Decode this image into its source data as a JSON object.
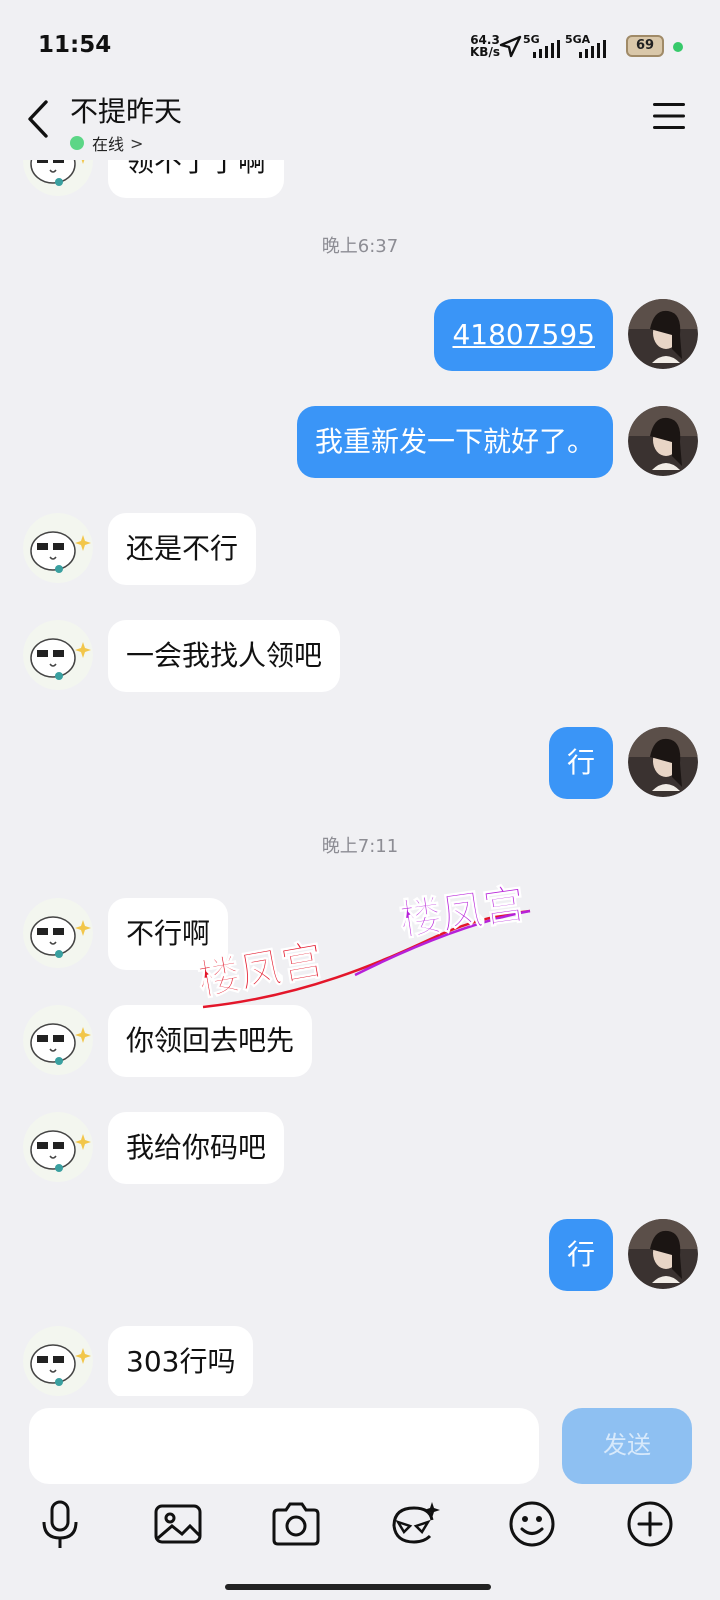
{
  "status_bar": {
    "time": "11:54",
    "net_speed_value": "64.3",
    "net_speed_unit": "KB/s",
    "sim1_label": "5G",
    "sim2_label": "5GA",
    "battery_level": "69",
    "indicator_color": "#37c96a"
  },
  "header": {
    "title": "不提昨天",
    "presence": "在线",
    "presence_chevron": ">",
    "back_icon": "chevron-left-icon",
    "menu_icon": "hamburger-menu-icon"
  },
  "messages": [
    {
      "side": "left",
      "type": "text",
      "text": "领不了了啊",
      "partially_hidden": true
    },
    {
      "type": "timestamp",
      "text": "晚上6:37"
    },
    {
      "side": "right",
      "type": "link",
      "text": "41807595"
    },
    {
      "side": "right",
      "type": "text",
      "text": "我重新发一下就好了。"
    },
    {
      "side": "left",
      "type": "text",
      "text": "还是不行"
    },
    {
      "side": "left",
      "type": "text",
      "text": "一会我找人领吧"
    },
    {
      "side": "right",
      "type": "text",
      "text": "行"
    },
    {
      "type": "timestamp",
      "text": "晚上7:11"
    },
    {
      "side": "left",
      "type": "text",
      "text": "不行啊"
    },
    {
      "side": "left",
      "type": "text",
      "text": "你领回去吧先"
    },
    {
      "side": "left",
      "type": "text",
      "text": "我给你码吧"
    },
    {
      "side": "right",
      "type": "text",
      "text": "行"
    },
    {
      "side": "left",
      "type": "text",
      "text": "303行吗",
      "partially_hidden": true
    }
  ],
  "watermark": {
    "text_1": "楼凤宫",
    "text_2": "楼凤宫"
  },
  "composer": {
    "input_value": "",
    "input_placeholder": "",
    "send_label": "发送"
  },
  "toolbar": {
    "icons": [
      "microphone-icon",
      "image-icon",
      "camera-icon",
      "sticker-icon",
      "emoji-icon",
      "plus-icon"
    ]
  },
  "colors": {
    "background": "#f0f0f3",
    "bubble_outgoing": "#3a95f7",
    "bubble_incoming": "#ffffff",
    "send_button_disabled": "#8ec0f2",
    "online_dot": "#5cd686"
  }
}
